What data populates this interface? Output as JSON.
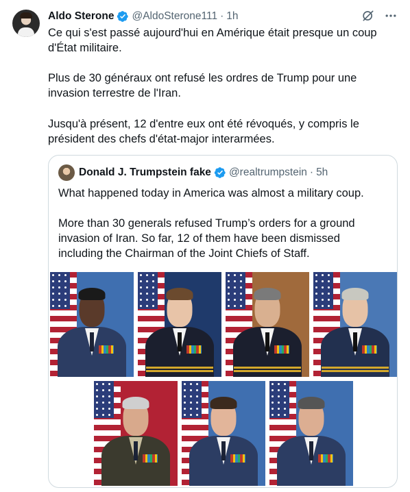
{
  "tweet": {
    "author_name": "Aldo Sterone",
    "handle": "@AldoSterone111",
    "separator": "·",
    "time": "1h",
    "paragraphs": [
      "Ce qui s'est passé aujourd'hui en Amérique était presque un coup\nd'État militaire.",
      "Plus de 30 généraux ont refusé les ordres de Trump pour une\ninvasion terrestre de l'Iran.",
      "Jusqu'à présent, 12 d'entre eux ont été révoqués, y compris le\nprésident des chefs d'état-major interarmées."
    ],
    "icons": {
      "verified": "verified-badge-icon",
      "grok": "grok-icon",
      "more": "more-options-icon"
    },
    "colors": {
      "verified": "#1d9bf0",
      "secondary_text": "#536471",
      "border": "#cfd9de"
    }
  },
  "quote": {
    "author_name": "Donald J. Trumpstein fake",
    "handle": "@realtrumpstein",
    "separator": "·",
    "time": "5h",
    "paragraphs": [
      "What happened today in America was almost a military coup.",
      "More than 30 generals refused Trump’s orders for a ground\ninvasion of Iran. So far, 12 of them have been dismissed\nincluding the Chairman of the Joint Chiefs of Staff."
    ],
    "photos_row1": [
      {
        "uniform": "air-force",
        "skin": "#5a3a2a",
        "hair": "#1a1a1a",
        "bg": "#3f6fb0"
      },
      {
        "uniform": "navy",
        "skin": "#e8c4a8",
        "hair": "#6b4a2e",
        "bg": "#1f3a6b"
      },
      {
        "uniform": "navy",
        "skin": "#d9b090",
        "hair": "#7a7a7a",
        "bg": "#a06a3c"
      },
      {
        "uniform": "navy-coast",
        "skin": "#e6c2a6",
        "hair": "#c8c8c0",
        "bg": "#4a78b5"
      }
    ],
    "photos_row2": [
      {
        "uniform": "army",
        "skin": "#d8a98c",
        "hair": "#cfcfcf",
        "bg": "#b22234"
      },
      {
        "uniform": "air-force",
        "skin": "#e2b59a",
        "hair": "#3b2a1e",
        "bg": "#3f6fb0"
      },
      {
        "uniform": "air-force",
        "skin": "#dcae92",
        "hair": "#555555",
        "bg": "#3f6fb0"
      }
    ]
  }
}
